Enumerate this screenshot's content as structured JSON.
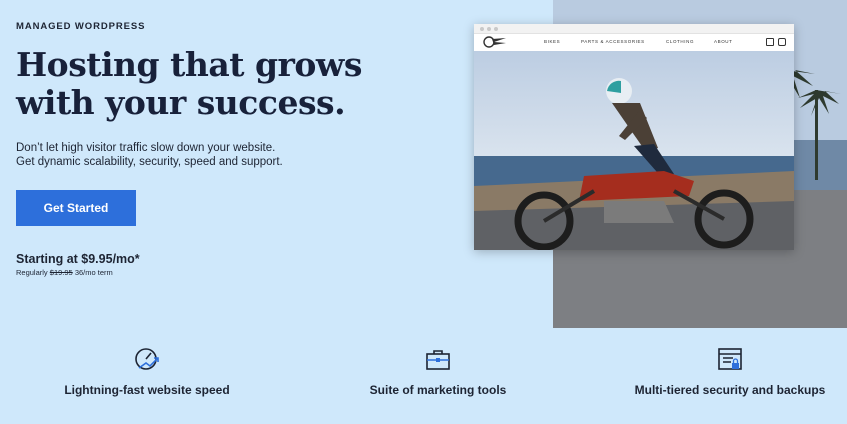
{
  "hero": {
    "eyebrow": "MANAGED WORDPRESS",
    "headline": "Hosting that grows with your success.",
    "subcopy_line1": "Don’t let high visitor traffic slow down your website.",
    "subcopy_line2": "Get dynamic scalability, security, speed and support.",
    "cta_label": "Get Started",
    "price_main": "Starting at $9.95/mo*",
    "price_regular_prefix": "Regularly",
    "price_regular_value": "$19.95",
    "price_term": "36/mo term"
  },
  "preview_site": {
    "nav": [
      "BIKES",
      "PARTS & ACCESSORIES",
      "CLOTHING",
      "ABOUT"
    ],
    "icons": [
      "youtube-icon",
      "instagram-icon"
    ]
  },
  "features": [
    {
      "label": "Lightning-fast website speed",
      "icon": "speedometer-icon"
    },
    {
      "label": "Suite of marketing tools",
      "icon": "briefcase-icon"
    },
    {
      "label": "Multi-tiered security and backups",
      "icon": "secure-browser-icon"
    }
  ],
  "colors": {
    "background": "#cfe8fb",
    "cta": "#2d6fdb",
    "headline": "#18213a"
  }
}
